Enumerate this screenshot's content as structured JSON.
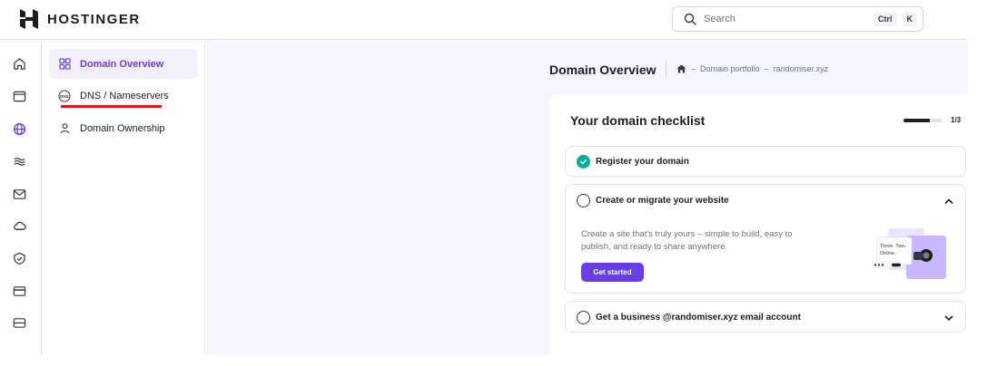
{
  "brand": {
    "name": "HOSTINGER"
  },
  "search": {
    "placeholder": "Search",
    "shortcut_mod": "Ctrl",
    "shortcut_key": "K"
  },
  "rail": {
    "icons": [
      "home-icon",
      "browser-icon",
      "globe-icon",
      "layers-icon",
      "mail-icon",
      "cloud-icon",
      "shield-icon",
      "credit-card-icon",
      "server-icon"
    ],
    "active": "globe-icon"
  },
  "subnav": {
    "items": [
      {
        "label": "Domain Overview",
        "icon": "grid-icon",
        "active": true
      },
      {
        "label": "DNS / Nameservers",
        "icon": "dns-icon",
        "active": false
      },
      {
        "label": "Domain Ownership",
        "icon": "user-icon",
        "active": false
      }
    ]
  },
  "header": {
    "title": "Domain Overview",
    "breadcrumb": [
      "Domain portfolio",
      "randomiser.xyz"
    ]
  },
  "checklist": {
    "title": "Your domain checklist",
    "progress_label": "1/3",
    "progress_fraction": 0.6667,
    "tasks": [
      {
        "label": "Register your domain",
        "done": true
      },
      {
        "label": "Create or migrate your website",
        "done": false,
        "expanded": true,
        "description": "Create a site that's truly yours – simple to build, easy to publish, and ready to share anywhere.",
        "button": "Get started",
        "illustration_text": [
          "Three. Two.",
          "Online."
        ]
      },
      {
        "label": "Get a business @randomiser.xyz email account",
        "done": false,
        "expanded": false
      }
    ]
  },
  "colors": {
    "accent": "#673de6",
    "success": "#00b090",
    "highlight": "#e3141b",
    "background": "#f4f5ff"
  }
}
